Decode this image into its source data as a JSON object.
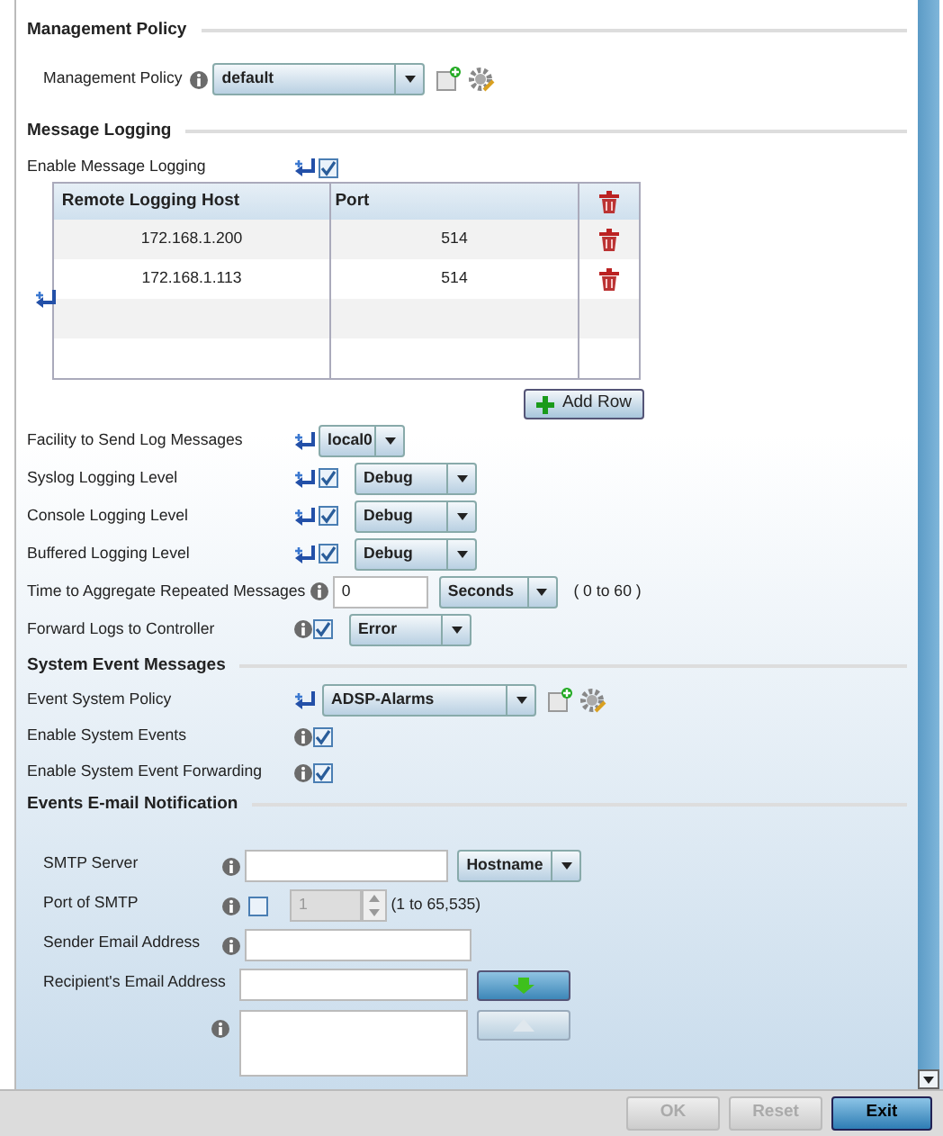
{
  "sections": [
    {
      "title": "Management Policy",
      "rows": [
        {
          "kind": "policy",
          "label": "Management Policy",
          "info": true,
          "value": "default"
        }
      ]
    },
    {
      "title": "Message Logging",
      "rows": [
        {
          "kind": "toggle",
          "label": "Enable Message Logging",
          "override": true,
          "checked": true
        },
        {
          "kind": "table",
          "columns": [
            "Remote Logging Host",
            "Port"
          ],
          "rows": [
            [
              "172.168.1.200",
              "514"
            ],
            [
              "172.168.1.113",
              "514"
            ]
          ],
          "add_button": "Add Row"
        },
        {
          "kind": "facility",
          "label": "Facility to Send Log Messages",
          "override": true,
          "value": "local0"
        },
        {
          "kind": "level",
          "label": "Syslog Logging Level",
          "override": true,
          "checked": true,
          "value": "Debug"
        },
        {
          "kind": "level",
          "label": "Console Logging Level",
          "override": true,
          "checked": true,
          "value": "Debug"
        },
        {
          "kind": "level",
          "label": "Buffered Logging Level",
          "override": true,
          "checked": true,
          "value": "Debug"
        },
        {
          "kind": "aggregate",
          "label": "Time to Aggregate Repeated Messages",
          "info": true,
          "input": "0",
          "value": "Seconds",
          "hint": "( 0 to 60 )"
        },
        {
          "kind": "level",
          "label": "Forward Logs to Controller",
          "info": true,
          "checked": true,
          "value": "Error"
        }
      ]
    },
    {
      "title": "System Event Messages",
      "rows": [
        {
          "kind": "policy",
          "label": "Event System Policy",
          "override": true,
          "value": "ADSP-Alarms"
        },
        {
          "kind": "toggle",
          "label": "Enable System Events",
          "info": true,
          "checked": true
        },
        {
          "kind": "toggle",
          "label": "Enable System Event Forwarding",
          "info": true,
          "checked": true
        }
      ]
    },
    {
      "title": "Events E-mail Notification",
      "rows": [
        {
          "kind": "server",
          "label": "SMTP Server",
          "info": true,
          "value": "Hostname"
        },
        {
          "kind": "port",
          "label": "Port of SMTP",
          "info": true,
          "checked": false,
          "input": "1",
          "hint": "(1 to 65,535)"
        },
        {
          "kind": "text",
          "label": "Sender Email Address",
          "info": true
        },
        {
          "kind": "recipient",
          "label": "Recipient's Email Address",
          "info": true
        }
      ]
    }
  ],
  "buttons": [
    {
      "label": "OK",
      "disabled": true
    },
    {
      "label": "Reset",
      "disabled": true
    },
    {
      "label": "Exit",
      "disabled": false
    }
  ]
}
